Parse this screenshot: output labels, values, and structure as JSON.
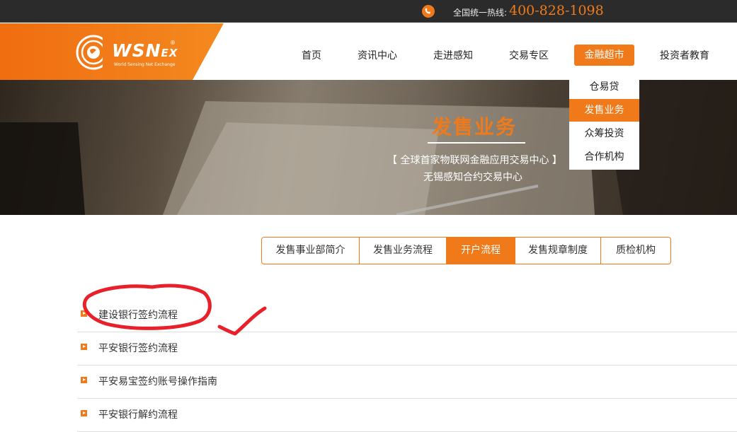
{
  "topbar": {
    "hotline_label": "全国统一热线:",
    "hotline_number": "400-828-1098",
    "phone_icon": "phone-icon"
  },
  "logo": {
    "brand": "WSN",
    "brand_suffix": "EX",
    "registered": "®",
    "tagline": "World Sensing Net Exchange"
  },
  "nav": {
    "items": [
      "首页",
      "资讯中心",
      "走进感知",
      "交易专区",
      "金融超市",
      "投资者教育"
    ],
    "active_index": 4
  },
  "dropdown": {
    "items": [
      "仓易贷",
      "发售业务",
      "众筹投资",
      "合作机构"
    ],
    "active_index": 1
  },
  "banner": {
    "title": "发售业务",
    "subtitle1": "【 全球首家物联网金融应用交易中心 】",
    "subtitle2": "无锡感知合约交易中心"
  },
  "tabs": {
    "items": [
      "发售事业部简介",
      "发售业务流程",
      "开户流程",
      "发售规章制度",
      "质检机构"
    ],
    "active_index": 2
  },
  "list": {
    "items": [
      "建设银行签约流程",
      "平安银行签约流程",
      "平安易宝签约账号操作指南",
      "平安银行解约流程"
    ]
  },
  "colors": {
    "accent": "#f07a1a",
    "topbar": "#2b2b2b",
    "annotation": "#e8202a"
  }
}
